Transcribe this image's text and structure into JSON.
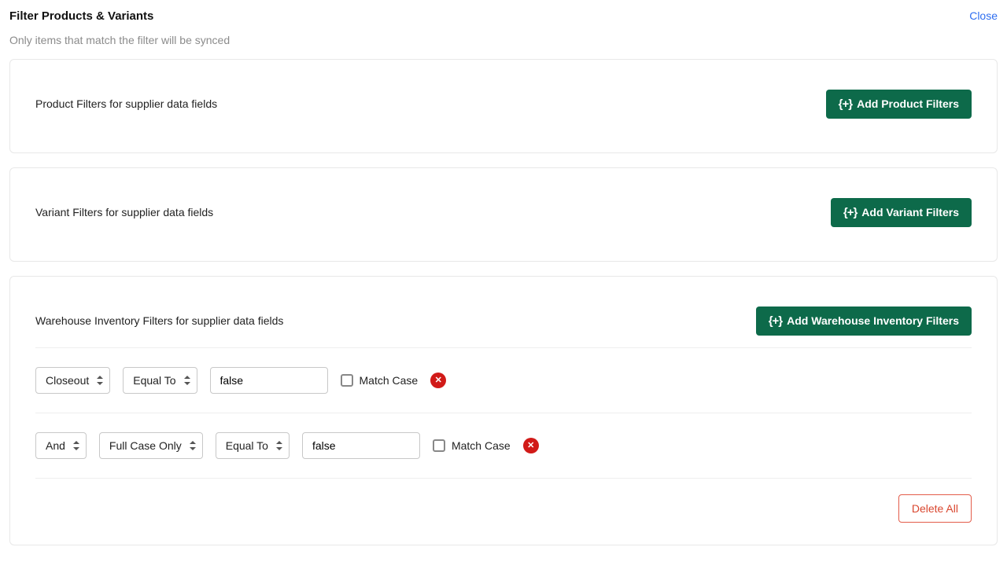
{
  "header": {
    "title": "Filter Products & Variants",
    "close": "Close",
    "subtitle": "Only items that match the filter will be synced"
  },
  "addIcon": "{+}",
  "productFilters": {
    "label": "Product Filters for supplier data fields",
    "addBtn": "Add Product Filters"
  },
  "variantFilters": {
    "label": "Variant Filters for supplier data fields",
    "addBtn": "Add Variant Filters"
  },
  "warehouseFilters": {
    "label": "Warehouse Inventory Filters for supplier data fields",
    "addBtn": "Add Warehouse Inventory Filters",
    "rows": [
      {
        "logic": null,
        "field": "Closeout",
        "op": "Equal To",
        "value": "false",
        "matchCaseLabel": "Match Case",
        "matchCase": false
      },
      {
        "logic": "And",
        "field": "Full Case Only",
        "op": "Equal To",
        "value": "false",
        "matchCaseLabel": "Match Case",
        "matchCase": false
      }
    ],
    "deleteAll": "Delete All"
  }
}
